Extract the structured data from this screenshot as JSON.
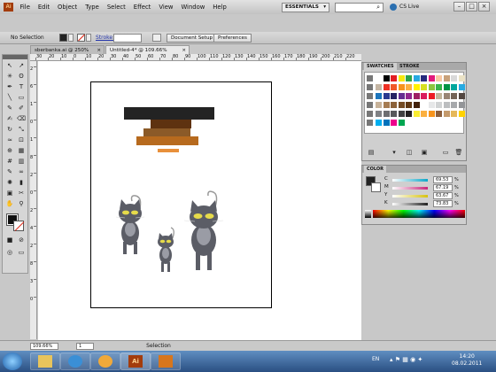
{
  "app": {
    "logo": "Ai",
    "workspace": "ESSENTIALS",
    "cs_live": "CS Live"
  },
  "menu": [
    "File",
    "Edit",
    "Object",
    "Type",
    "Select",
    "Effect",
    "View",
    "Window",
    "Help"
  ],
  "control": {
    "no_selection": "No Selection",
    "stroke_label": "Stroke:",
    "document_setup": "Document Setup",
    "preferences": "Preferences"
  },
  "tabs": [
    {
      "label": "sberbanka.ai @ 250% (CMYK/Preview)",
      "active": false
    },
    {
      "label": "Untitled-4* @ 109.66% (CMYK/Preview)",
      "active": true
    }
  ],
  "ruler": {
    "h": [
      "30",
      "20",
      "10",
      "0",
      "10",
      "20",
      "30",
      "40",
      "50",
      "60",
      "70",
      "80",
      "90",
      "100",
      "110",
      "120",
      "130",
      "140",
      "150",
      "160",
      "170",
      "180",
      "190",
      "200",
      "210",
      "220"
    ],
    "v": [
      "2",
      "6",
      "1",
      "0",
      "1",
      "8",
      "2",
      "0",
      "2",
      "4",
      "2",
      "8",
      "3",
      "0"
    ]
  },
  "swatches_panel": {
    "tabs": [
      "SWATCHES",
      "STROKE"
    ]
  },
  "color_panel": {
    "title": "COLOR",
    "channels": [
      {
        "label": "C",
        "value": "69.53",
        "pct": "%",
        "color": "#0aa6c8"
      },
      {
        "label": "M",
        "value": "67.19",
        "pct": "%",
        "color": "#c8257a"
      },
      {
        "label": "Y",
        "value": "63.67",
        "pct": "%",
        "color": "#d6c210"
      },
      {
        "label": "K",
        "value": "73.83",
        "pct": "%",
        "color": "#222222"
      }
    ]
  },
  "status": {
    "zoom": "109.66%",
    "page": "1",
    "selection": "Selection"
  },
  "taskbar": {
    "lang": "EN",
    "time": "14:20",
    "date": "08.02.2011"
  },
  "colors": {
    "bar_dark": "#232323",
    "bar_brown1": "#5e3210",
    "bar_brown2": "#8b5a28",
    "bar_orange": "#b76a1e",
    "bar_orange2": "#e8903b",
    "cat_body": "#5b5d66",
    "cat_eye": "#e6db4a"
  }
}
